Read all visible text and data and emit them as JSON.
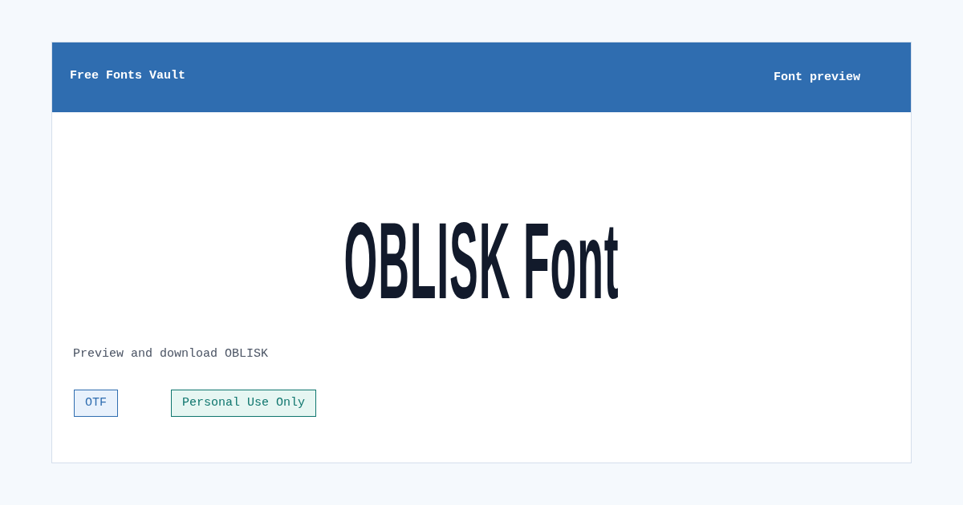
{
  "header": {
    "site_name": "Free Fonts Vault",
    "page_label": "Font preview"
  },
  "preview": {
    "title": "OBLISK Font",
    "subtitle": "Preview and download OBLISK"
  },
  "tags": [
    {
      "label": "OTF",
      "kind": "format"
    },
    {
      "label": "Personal Use Only",
      "kind": "license"
    }
  ]
}
